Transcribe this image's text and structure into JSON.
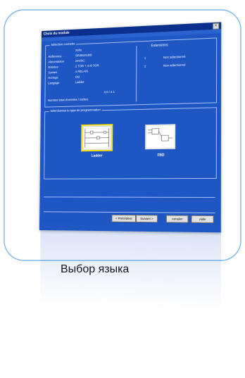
{
  "caption": "Выбор языка",
  "window": {
    "title": "Choix du module",
    "close_glyph": "×"
  },
  "module_group": {
    "title": "Sélection courante",
    "fields": [
      {
        "label": "",
        "value": "Zelio"
      },
      {
        "label": "Référence",
        "value": "SR3B101BD"
      },
      {
        "label": "Alimentation",
        "value": "24VDC"
      },
      {
        "label": "Entrées",
        "value": "2 TOR + 4 I0 TOR"
      },
      {
        "label": "Sorties",
        "value": "4 RELAIS"
      },
      {
        "label": "Horloge",
        "value": "Oui"
      },
      {
        "label": "Langage",
        "value": "Ladder"
      }
    ],
    "version": "3.0 / 4.1",
    "footer": "Nombre total d'entrées / sorties"
  },
  "extensions": {
    "title": "Extensions",
    "items": [
      {
        "index": "1",
        "value": "Non sélectionné"
      },
      {
        "index": "2",
        "value": "Non sélectionné"
      }
    ]
  },
  "language_group": {
    "title": "Sélectionner le type de programmation",
    "options": [
      {
        "label": "Ladder",
        "selected": true
      },
      {
        "label": "FBD",
        "selected": false
      }
    ]
  },
  "buttons": {
    "previous": "< Précédent",
    "next": "Suivant >",
    "cancel": "Annuler",
    "help": "Aide"
  },
  "colors": {
    "window_bg": "#1e57c4",
    "titlebar": "#0b2f8c",
    "highlight": "#f2d900"
  }
}
